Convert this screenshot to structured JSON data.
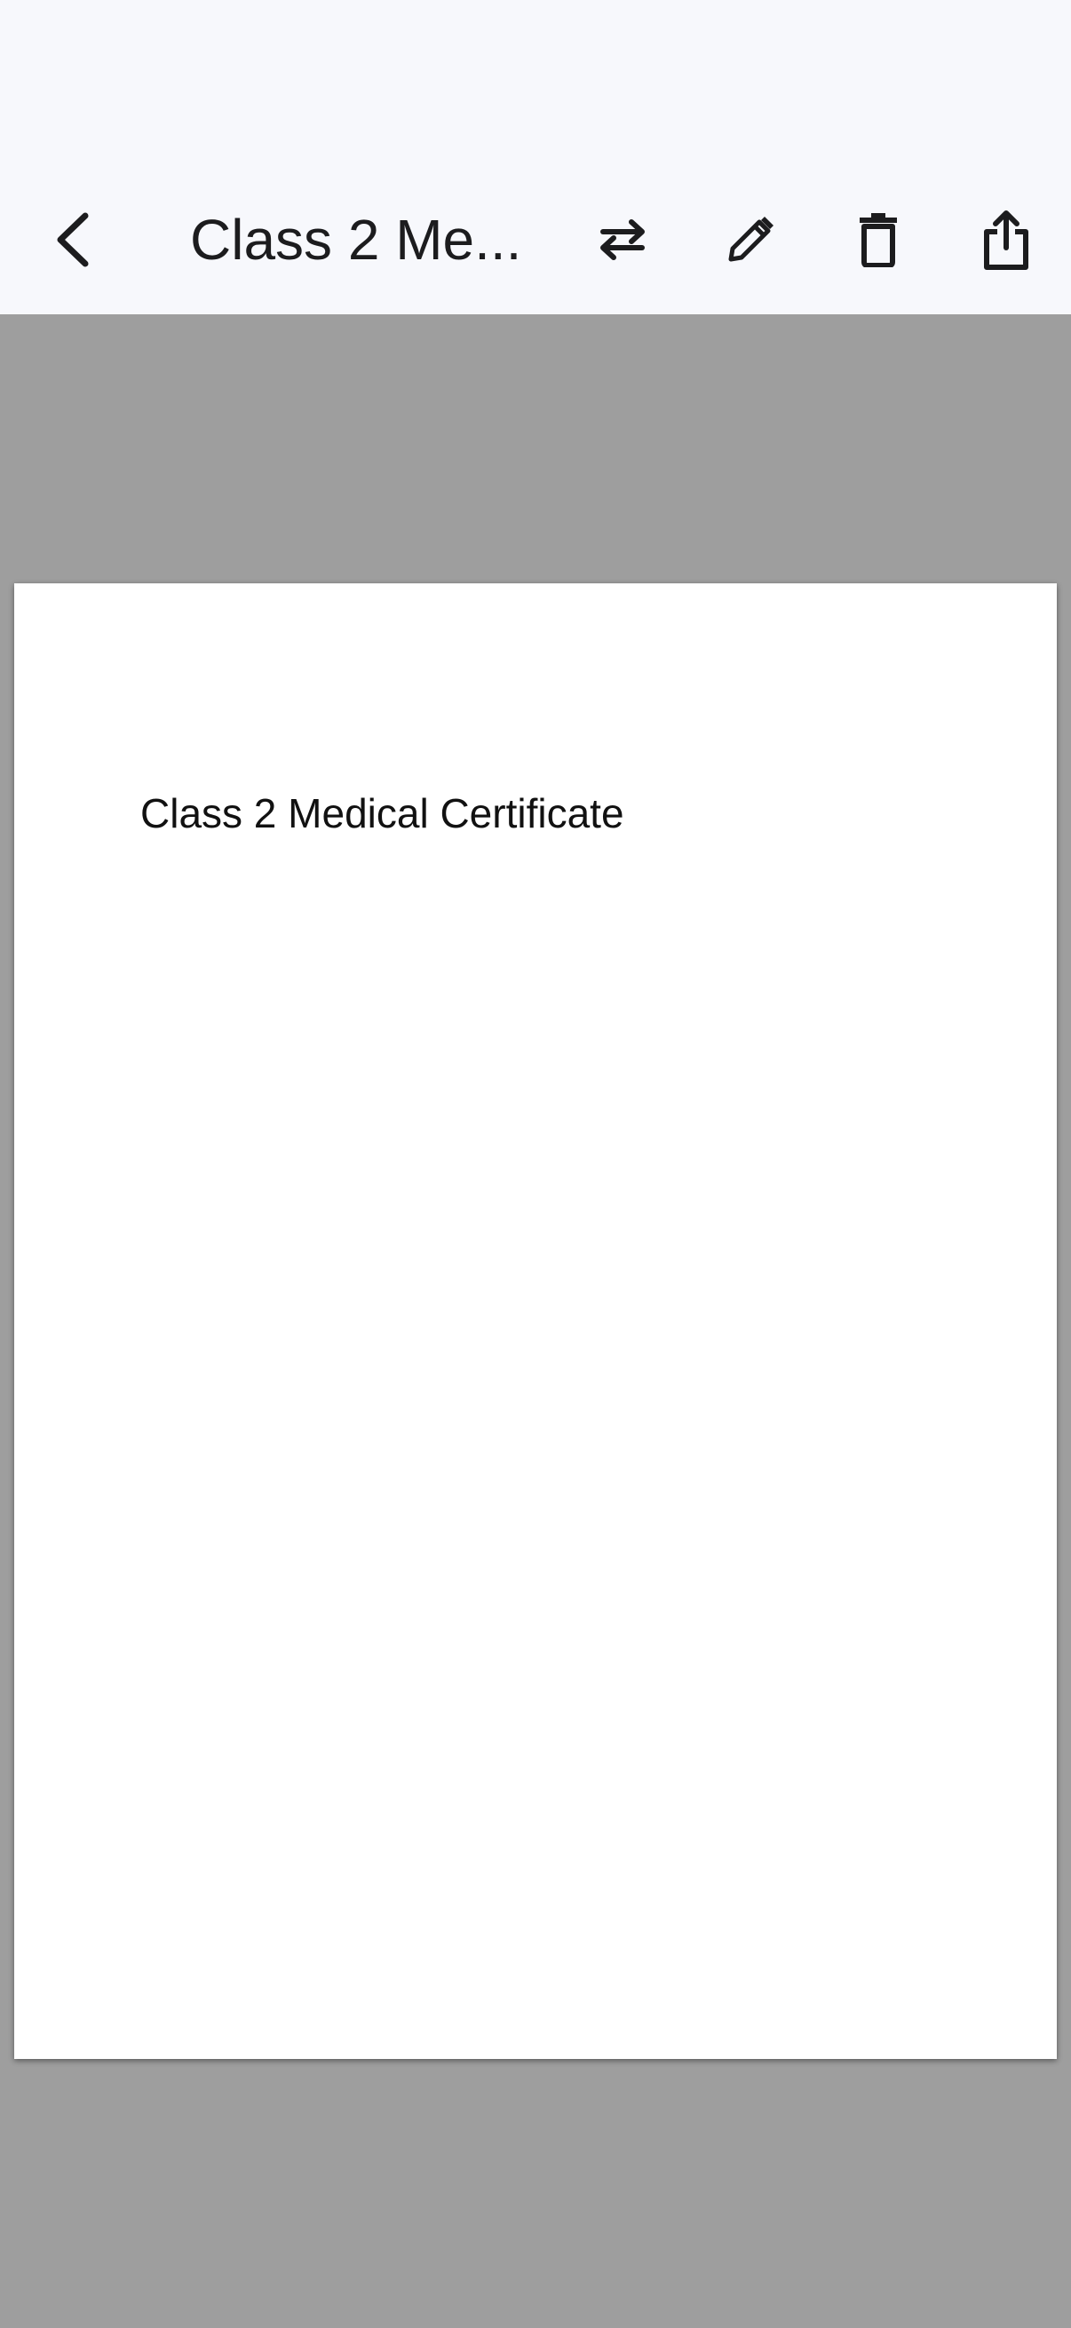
{
  "header": {
    "title": "Class 2 Me..."
  },
  "toolbar": {
    "icons": [
      "chevron-left-icon",
      "swap-icon",
      "pencil-icon",
      "trash-icon",
      "share-icon"
    ]
  },
  "document": {
    "heading": "Class 2 Medical Certificate"
  },
  "colors": {
    "toolbar_bg": "#f7f8fc",
    "viewer_bg": "#9e9e9e",
    "page_bg": "#ffffff",
    "icon": "#1c1c1e"
  }
}
